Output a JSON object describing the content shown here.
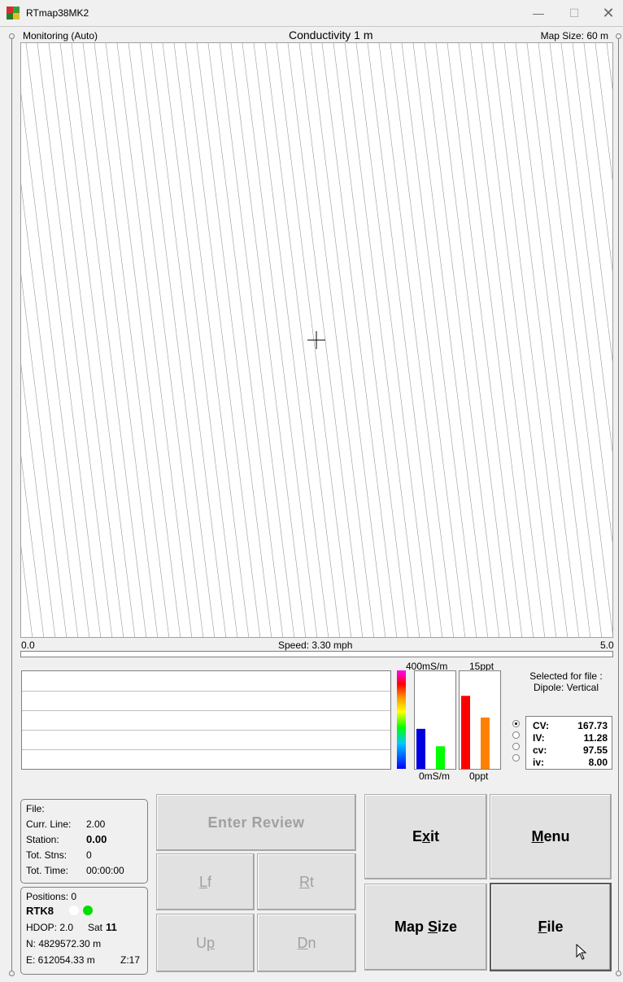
{
  "window": {
    "title": "RTmap38MK2",
    "minimize_glyph": "—",
    "maximize_glyph": "☐",
    "close_glyph": "✕"
  },
  "header": {
    "mode": "Monitoring (Auto)",
    "measure": "Conductivity 1 m",
    "map_size": "Map Size:  60 m"
  },
  "map": {
    "crosshair_icon": "crosshair-icon"
  },
  "scale": {
    "left": "0.0",
    "speed": "Speed:  3.30 mph",
    "right": "5.0"
  },
  "bars": {
    "ms_top": "400mS/m",
    "ms_bottom": "0mS/m",
    "ppt_top": "15ppt",
    "ppt_bottom": "0ppt",
    "conductivity_max": 400,
    "salinity_max": 15,
    "conductivity_series": [
      {
        "name": "CV",
        "color": "#0000e0",
        "value": 167.73
      },
      {
        "name": "cv",
        "color": "#00ff00",
        "value": 97.55
      }
    ],
    "salinity_series": [
      {
        "name": "IV",
        "color": "#ff0000",
        "value": 11.28
      },
      {
        "name": "iv",
        "color": "#ff8000",
        "value": 8.0
      }
    ]
  },
  "selected_for_file": {
    "line1": "Selected for file :",
    "line2": "Dipole: Vertical"
  },
  "readings": [
    {
      "name": "CV:",
      "value": "167.73",
      "selected": true
    },
    {
      "name": "IV:",
      "value": "11.28",
      "selected": false
    },
    {
      "name": "cv:",
      "value": "97.55",
      "selected": false
    },
    {
      "name": "iv:",
      "value": "8.00",
      "selected": false
    }
  ],
  "file_info": {
    "file_label": "File:",
    "curr_line_label": "Curr. Line:",
    "curr_line_value": "2.00",
    "station_label": "Station:",
    "station_value": "0.00",
    "tot_stns_label": "Tot. Stns:",
    "tot_stns_value": "0",
    "tot_time_label": "Tot. Time:",
    "tot_time_value": "00:00:00"
  },
  "gps_info": {
    "positions": "Positions:  0",
    "rtk": "RTK8",
    "hdop": "HDOP: 2.0",
    "sat_label": "Sat",
    "sat_value": "11",
    "north": "N:  4829572.30 m",
    "east": "E:  612054.33 m",
    "zone": "Z:17"
  },
  "buttons": {
    "enter_review": "Enter Review",
    "lf_a": "L",
    "lf_b": "f",
    "rt_a": "R",
    "rt_b": "t",
    "up_a": "U",
    "up_b": "p",
    "dn_a": "D",
    "dn_b": "n",
    "exit_a": "E",
    "exit_b": "x",
    "exit_c": "it",
    "menu_a": "M",
    "menu_b": "enu",
    "mapsize_a": "Map ",
    "mapsize_b": "S",
    "mapsize_c": "ize",
    "file_a": "F",
    "file_b": "ile"
  }
}
